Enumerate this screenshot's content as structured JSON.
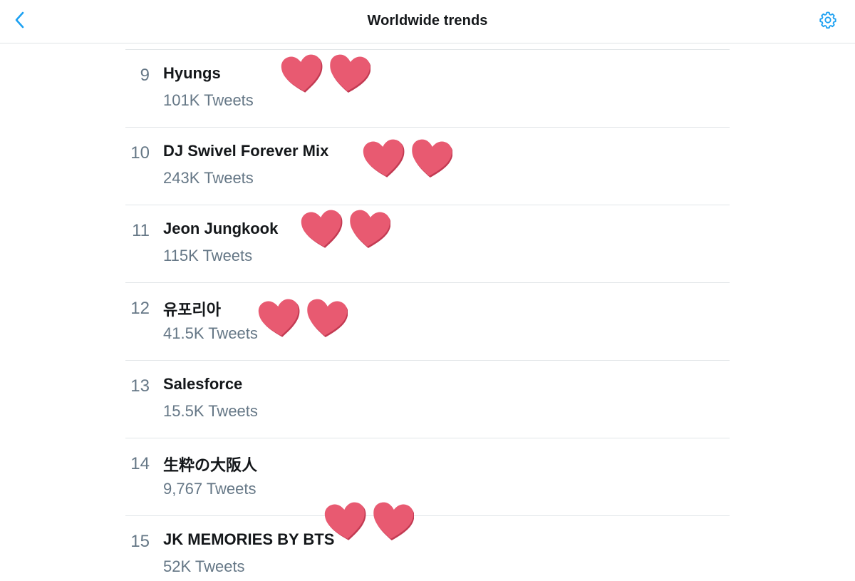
{
  "header": {
    "title": "Worldwide trends",
    "back_icon": "chevron-left-icon",
    "settings_icon": "gear-icon"
  },
  "colors": {
    "accent": "#1da1f2",
    "text_primary": "#14171a",
    "text_secondary": "#657786",
    "divider": "#e1e5e8",
    "heart": "#e85a71"
  },
  "trends": [
    {
      "rank": "9",
      "name": "Hyungs",
      "count": "101K Tweets",
      "hearts": true
    },
    {
      "rank": "10",
      "name": "DJ Swivel Forever Mix",
      "count": "243K Tweets",
      "hearts": true
    },
    {
      "rank": "11",
      "name": "Jeon Jungkook",
      "count": "115K Tweets",
      "hearts": true
    },
    {
      "rank": "12",
      "name": "유포리아",
      "count": "41.5K Tweets",
      "hearts": true
    },
    {
      "rank": "13",
      "name": "Salesforce",
      "count": "15.5K Tweets",
      "hearts": false
    },
    {
      "rank": "14",
      "name": "生粋の大阪人",
      "count": "9,767 Tweets",
      "hearts": false
    },
    {
      "rank": "15",
      "name": "JK MEMORIES BY BTS",
      "count": "52K Tweets",
      "hearts": true
    }
  ]
}
